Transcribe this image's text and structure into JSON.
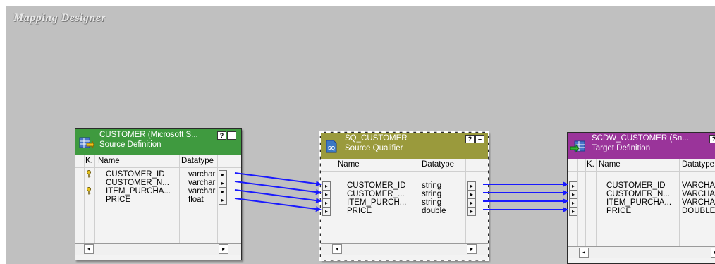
{
  "canvas": {
    "title": "Mapping Designer"
  },
  "source": {
    "title": "CUSTOMER (Microsoft S...",
    "subtitle": "Source Definition",
    "header_color": "#3f9a3f",
    "columns": {
      "key": "K.",
      "name": "Name",
      "datatype": "Datatype"
    },
    "rows": [
      {
        "name": "CUSTOMER_ID",
        "datatype": "varchar",
        "key": true
      },
      {
        "name": "CUSTOMER_N...",
        "datatype": "varchar",
        "key": false
      },
      {
        "name": "ITEM_PURCHA...",
        "datatype": "varchar",
        "key": true
      },
      {
        "name": "PRICE",
        "datatype": "float",
        "key": false
      }
    ]
  },
  "qualifier": {
    "title": "SQ_CUSTOMER",
    "subtitle": "Source Qualifier",
    "header_color": "#9a9a3c",
    "columns": {
      "name": "Name",
      "datatype": "Datatype"
    },
    "rows": [
      {
        "name": "CUSTOMER_ID",
        "datatype": "string"
      },
      {
        "name": "CUSTOMER_...",
        "datatype": "string"
      },
      {
        "name": "ITEM_PURCH...",
        "datatype": "string"
      },
      {
        "name": "PRICE",
        "datatype": "double"
      }
    ]
  },
  "target": {
    "title": "SCDW_CUSTOMER (Sn...",
    "subtitle": "Target Definition",
    "header_color": "#9a349a",
    "columns": {
      "key": "K.",
      "name": "Name",
      "datatype": "Datatype"
    },
    "rows": [
      {
        "name": "CUSTOMER_ID",
        "datatype": "VARCHA"
      },
      {
        "name": "CUSTOMER_N...",
        "datatype": "VARCHA"
      },
      {
        "name": "ITEM_PURCHA...",
        "datatype": "VARCHA"
      },
      {
        "name": "PRICE",
        "datatype": "DOUBLE"
      }
    ]
  },
  "link_color": "#1a1aff"
}
